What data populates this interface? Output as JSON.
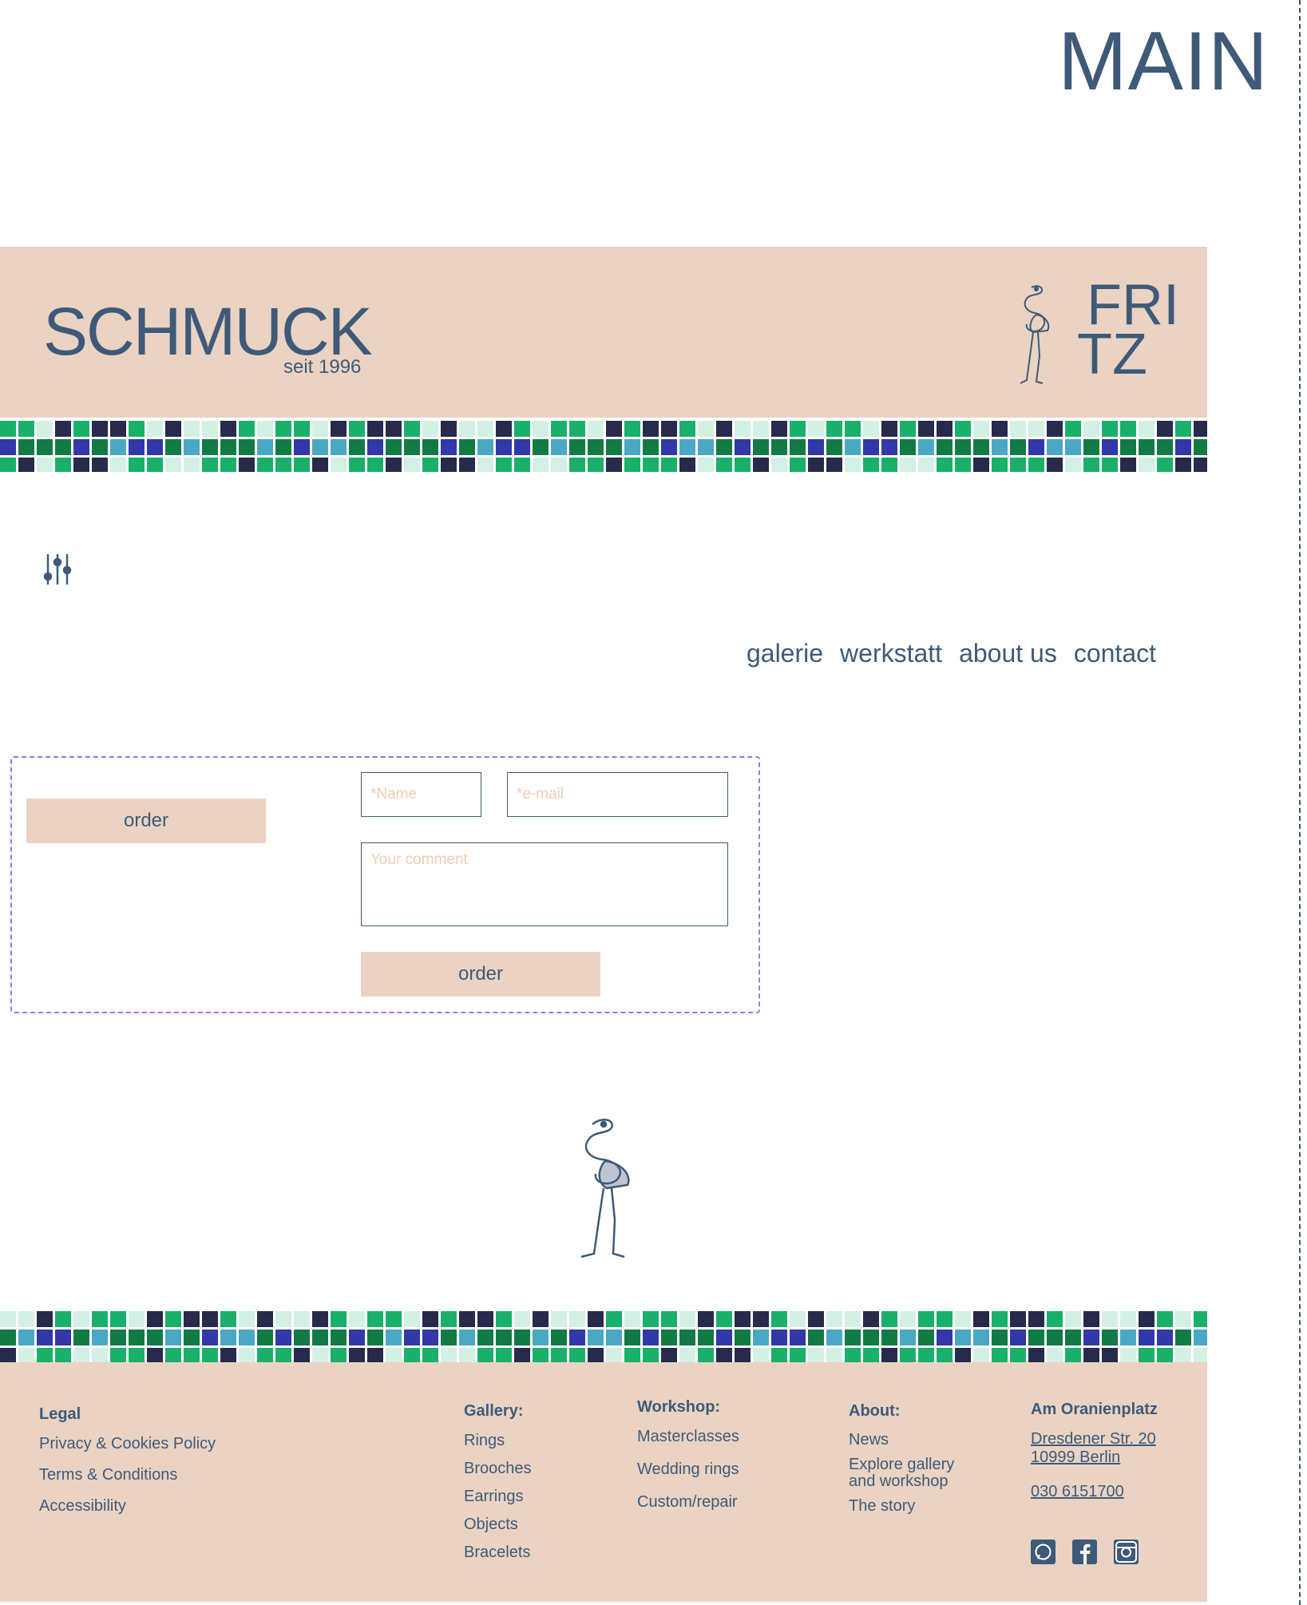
{
  "page": {
    "main_label": "MAIN"
  },
  "header": {
    "title": "SCHMUCK",
    "subtitle": "seit 1996",
    "logo_line1": "FRI",
    "logo_line2": "TZ"
  },
  "nav": {
    "items": [
      {
        "label": "galerie"
      },
      {
        "label": "werkstatt"
      },
      {
        "label": "about us"
      },
      {
        "label": "contact"
      }
    ],
    "active": "about us"
  },
  "form": {
    "left_button": "order",
    "name_placeholder": "*Name",
    "email_placeholder": "*e-mail",
    "comment_placeholder": "Your comment",
    "submit_button": "order"
  },
  "footer": {
    "legal": {
      "heading": "Legal",
      "items": [
        "Privacy & Cookies Policy",
        "Terms & Conditions",
        "Accessibility"
      ]
    },
    "gallery": {
      "heading": "Gallery:",
      "items": [
        "Rings",
        "Brooches",
        "Earrings",
        "Objects",
        "Bracelets"
      ]
    },
    "workshop": {
      "heading": "Workshop:",
      "items": [
        "Masterclasses",
        "Wedding rings",
        "Custom/repair"
      ]
    },
    "about": {
      "heading": "About:",
      "items": [
        "News",
        "Explore gallery and workshop",
        "The story"
      ]
    },
    "address": {
      "heading": "Am Oranienplatz",
      "street": "Dresdener Str. 20",
      "city": "10999 Berlin",
      "phone": "030 6151700"
    },
    "social": [
      "whatsapp-icon",
      "facebook-icon",
      "instagram-icon"
    ]
  },
  "colors": {
    "accent_blue": "#3f5a78",
    "band_beige": "#ead3c3",
    "tile_navy": "#272a4a",
    "tile_green": "#19b06b",
    "tile_dark_green": "#127a45",
    "tile_teal": "#4aa8c4",
    "tile_indigo": "#3238a8",
    "tile_mint": "#d3f0e4",
    "form_border": "#a86ff0"
  }
}
